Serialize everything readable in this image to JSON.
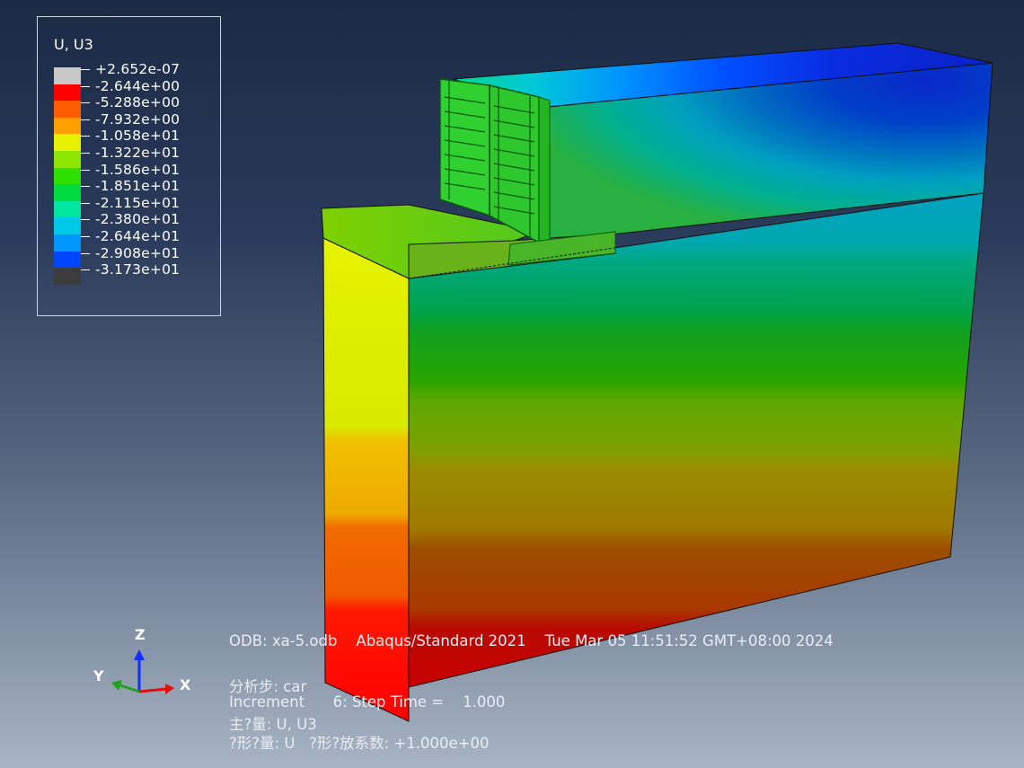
{
  "legend": {
    "title": "U, U3",
    "entries": [
      {
        "label": "+2.652e-07",
        "color": "#c8c8c8"
      },
      {
        "label": "-2.644e+00",
        "color": "#ff0000"
      },
      {
        "label": "-5.288e+00",
        "color": "#ff5c00"
      },
      {
        "label": "-7.932e+00",
        "color": "#ffa000"
      },
      {
        "label": "-1.058e+01",
        "color": "#e6f000"
      },
      {
        "label": "-1.322e+01",
        "color": "#8ce600"
      },
      {
        "label": "-1.586e+01",
        "color": "#2ee000"
      },
      {
        "label": "-1.851e+01",
        "color": "#00dc40"
      },
      {
        "label": "-2.115e+01",
        "color": "#00e6a0"
      },
      {
        "label": "-2.380e+01",
        "color": "#00c8e6"
      },
      {
        "label": "-2.644e+01",
        "color": "#0096ff"
      },
      {
        "label": "-2.908e+01",
        "color": "#0046ff"
      },
      {
        "label": "-3.173e+01",
        "color": "#3c3c3c"
      }
    ]
  },
  "info": {
    "odb_line": "ODB: xa-5.odb    Abaqus/Standard 2021    Tue Mar 05 11:51:52 GMT+08:00 2024",
    "step_line": "分析步: car",
    "increment_line": "Increment      6: Step Time =    1.000",
    "primary_var_line": "主?量: U, U3",
    "deformed_var_line": "?形?量: U   ?形?放系数: +1.000e+00"
  },
  "triad": {
    "x_label": "X",
    "y_label": "Y",
    "z_label": "Z"
  }
}
